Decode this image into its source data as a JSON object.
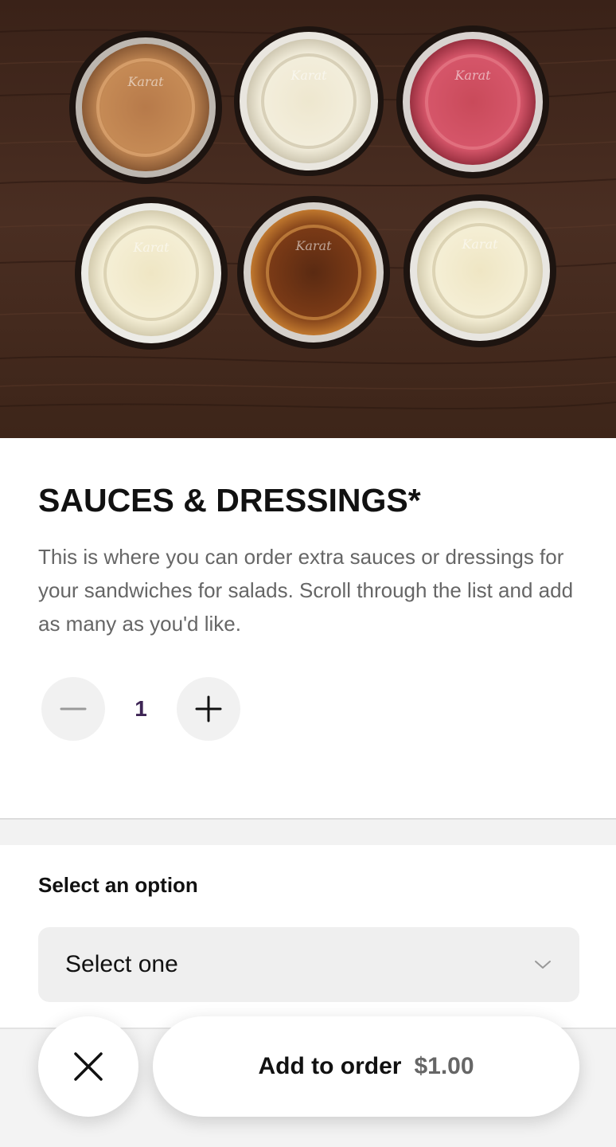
{
  "item": {
    "title": "SAUCES & DRESSINGS*",
    "description": "This is where you can order extra sauces or dressings for your sandwiches for salads. Scroll through the list and add as many as you'd like.",
    "image_subject": "six-sauce-cups-photo",
    "cup_lid_text": "Karat"
  },
  "stepper": {
    "quantity": "1",
    "decrement_icon": "minus-icon",
    "increment_icon": "plus-icon"
  },
  "options": {
    "label": "Select an option",
    "select_value": "Select one",
    "select_icon": "chevron-down-icon"
  },
  "footer": {
    "close_icon": "close-icon",
    "add_label": "Add to order",
    "price": "$1.00"
  },
  "colors": {
    "quantity_text": "#3d2454",
    "select_bg": "#efefef",
    "footer_bg": "#f3f3f3"
  }
}
